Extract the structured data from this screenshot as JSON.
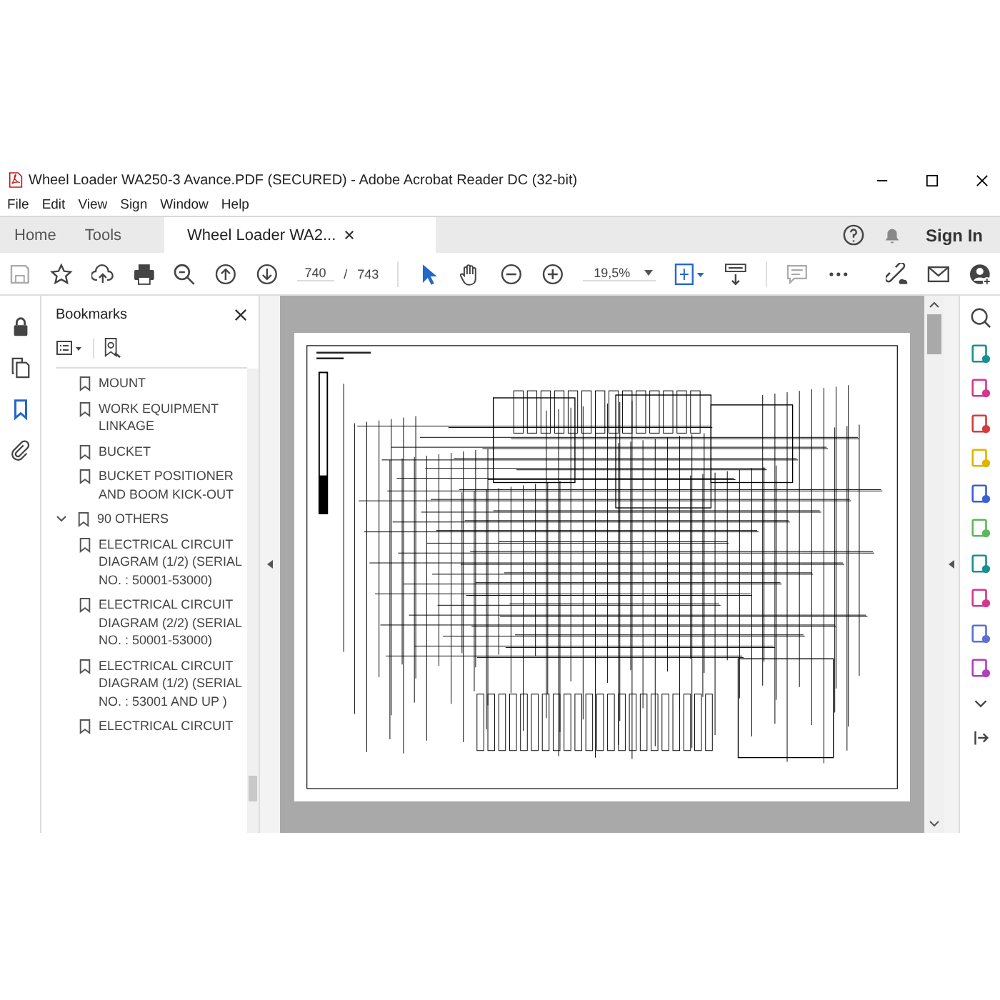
{
  "window": {
    "title": "Wheel Loader WA250-3 Avance.PDF (SECURED) - Adobe Acrobat Reader DC (32-bit)"
  },
  "menu": [
    "File",
    "Edit",
    "View",
    "Sign",
    "Window",
    "Help"
  ],
  "tabs": [
    {
      "label": "Home",
      "selected": false
    },
    {
      "label": "Tools",
      "selected": false
    },
    {
      "label": "Wheel Loader WA2...",
      "selected": true
    }
  ],
  "sign_in": "Sign In",
  "toolbar": {
    "page_current": "740",
    "page_separator": "/",
    "page_total": "743",
    "zoom": "19,5%"
  },
  "sidebar": {
    "title": "Bookmarks",
    "bookmarks": [
      {
        "label": "MOUNT"
      },
      {
        "label": "WORK EQUIPMENT LINKAGE"
      },
      {
        "label": "BUCKET"
      },
      {
        "label": "BUCKET POSITIONER AND BOOM KICK-OUT"
      },
      {
        "label": "90 OTHERS",
        "expanded": true,
        "children": [
          {
            "label": "ELECTRICAL CIRCUIT DIAGRAM (1/2) (SERIAL NO. : 50001-53000)"
          },
          {
            "label": "ELECTRICAL CIRCUIT DIAGRAM (2/2) (SERIAL NO. : 50001-53000)"
          },
          {
            "label": "ELECTRICAL CIRCUIT DIAGRAM (1/2) (SERIAL NO. : 53001 AND UP )"
          },
          {
            "label": "ELECTRICAL CIRCUIT"
          }
        ]
      }
    ]
  }
}
